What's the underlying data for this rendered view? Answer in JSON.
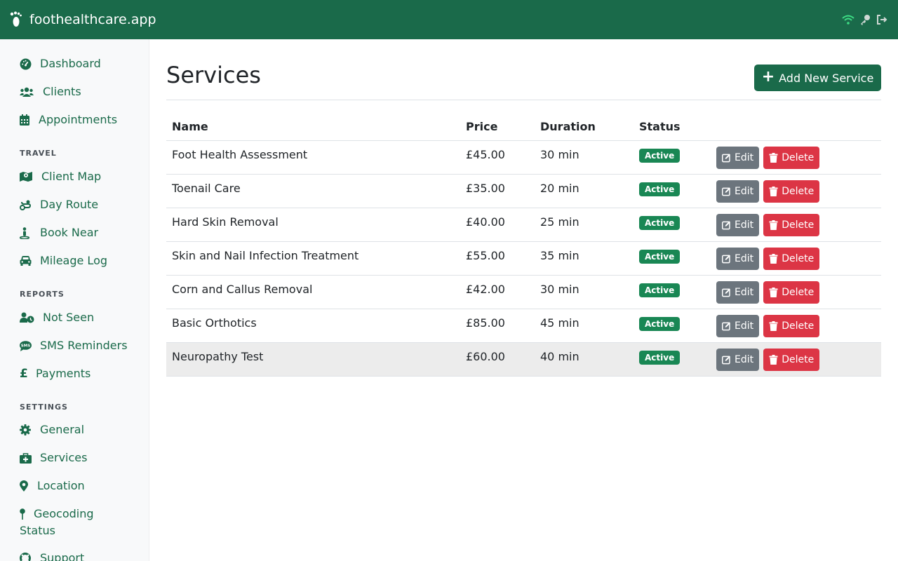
{
  "app": {
    "title": "foothealthcare.app"
  },
  "sidebar": {
    "main_items": [
      {
        "label": "Dashboard",
        "icon": "dashboard-icon"
      },
      {
        "label": "Clients",
        "icon": "users-icon"
      },
      {
        "label": "Appointments",
        "icon": "calendar-icon"
      }
    ],
    "sections": [
      {
        "heading": "TRAVEL",
        "items": [
          {
            "label": "Client Map",
            "icon": "map-icon"
          },
          {
            "label": "Day Route",
            "icon": "route-icon"
          },
          {
            "label": "Book Near",
            "icon": "location-person-icon"
          },
          {
            "label": "Mileage Log",
            "icon": "car-icon"
          }
        ]
      },
      {
        "heading": "REPORTS",
        "items": [
          {
            "label": "Not Seen",
            "icon": "user-clock-icon"
          },
          {
            "label": "SMS Reminders",
            "icon": "sms-icon"
          },
          {
            "label": "Payments",
            "icon": "pound-icon"
          }
        ]
      },
      {
        "heading": "SETTINGS",
        "items": [
          {
            "label": "General",
            "icon": "gear-icon"
          },
          {
            "label": "Services",
            "icon": "medkit-icon"
          },
          {
            "label": "Location",
            "icon": "map-pin-icon"
          },
          {
            "label": "Geocoding Status",
            "icon": "pin-icon"
          },
          {
            "label": "Support",
            "icon": "lifebuoy-icon"
          }
        ]
      }
    ]
  },
  "page": {
    "title": "Services",
    "add_button": "Add New Service"
  },
  "table": {
    "columns": [
      "Name",
      "Price",
      "Duration",
      "Status",
      ""
    ],
    "rows": [
      {
        "name": "Foot Health Assessment",
        "price": "£45.00",
        "duration": "30 min",
        "status": "Active"
      },
      {
        "name": "Toenail Care",
        "price": "£35.00",
        "duration": "20 min",
        "status": "Active"
      },
      {
        "name": "Hard Skin Removal",
        "price": "£40.00",
        "duration": "25 min",
        "status": "Active"
      },
      {
        "name": "Skin and Nail Infection Treatment",
        "price": "£55.00",
        "duration": "35 min",
        "status": "Active"
      },
      {
        "name": "Corn and Callus Removal",
        "price": "£42.00",
        "duration": "30 min",
        "status": "Active"
      },
      {
        "name": "Basic Orthotics",
        "price": "£85.00",
        "duration": "45 min",
        "status": "Active"
      },
      {
        "name": "Neuropathy Test",
        "price": "£60.00",
        "duration": "40 min",
        "status": "Active"
      }
    ],
    "edit_label": "Edit",
    "delete_label": "Delete"
  },
  "colors": {
    "brand": "#1a6a4a",
    "active_badge": "#198754",
    "edit": "#6c757d",
    "delete": "#dc3545",
    "wifi": "#3ddc84"
  }
}
